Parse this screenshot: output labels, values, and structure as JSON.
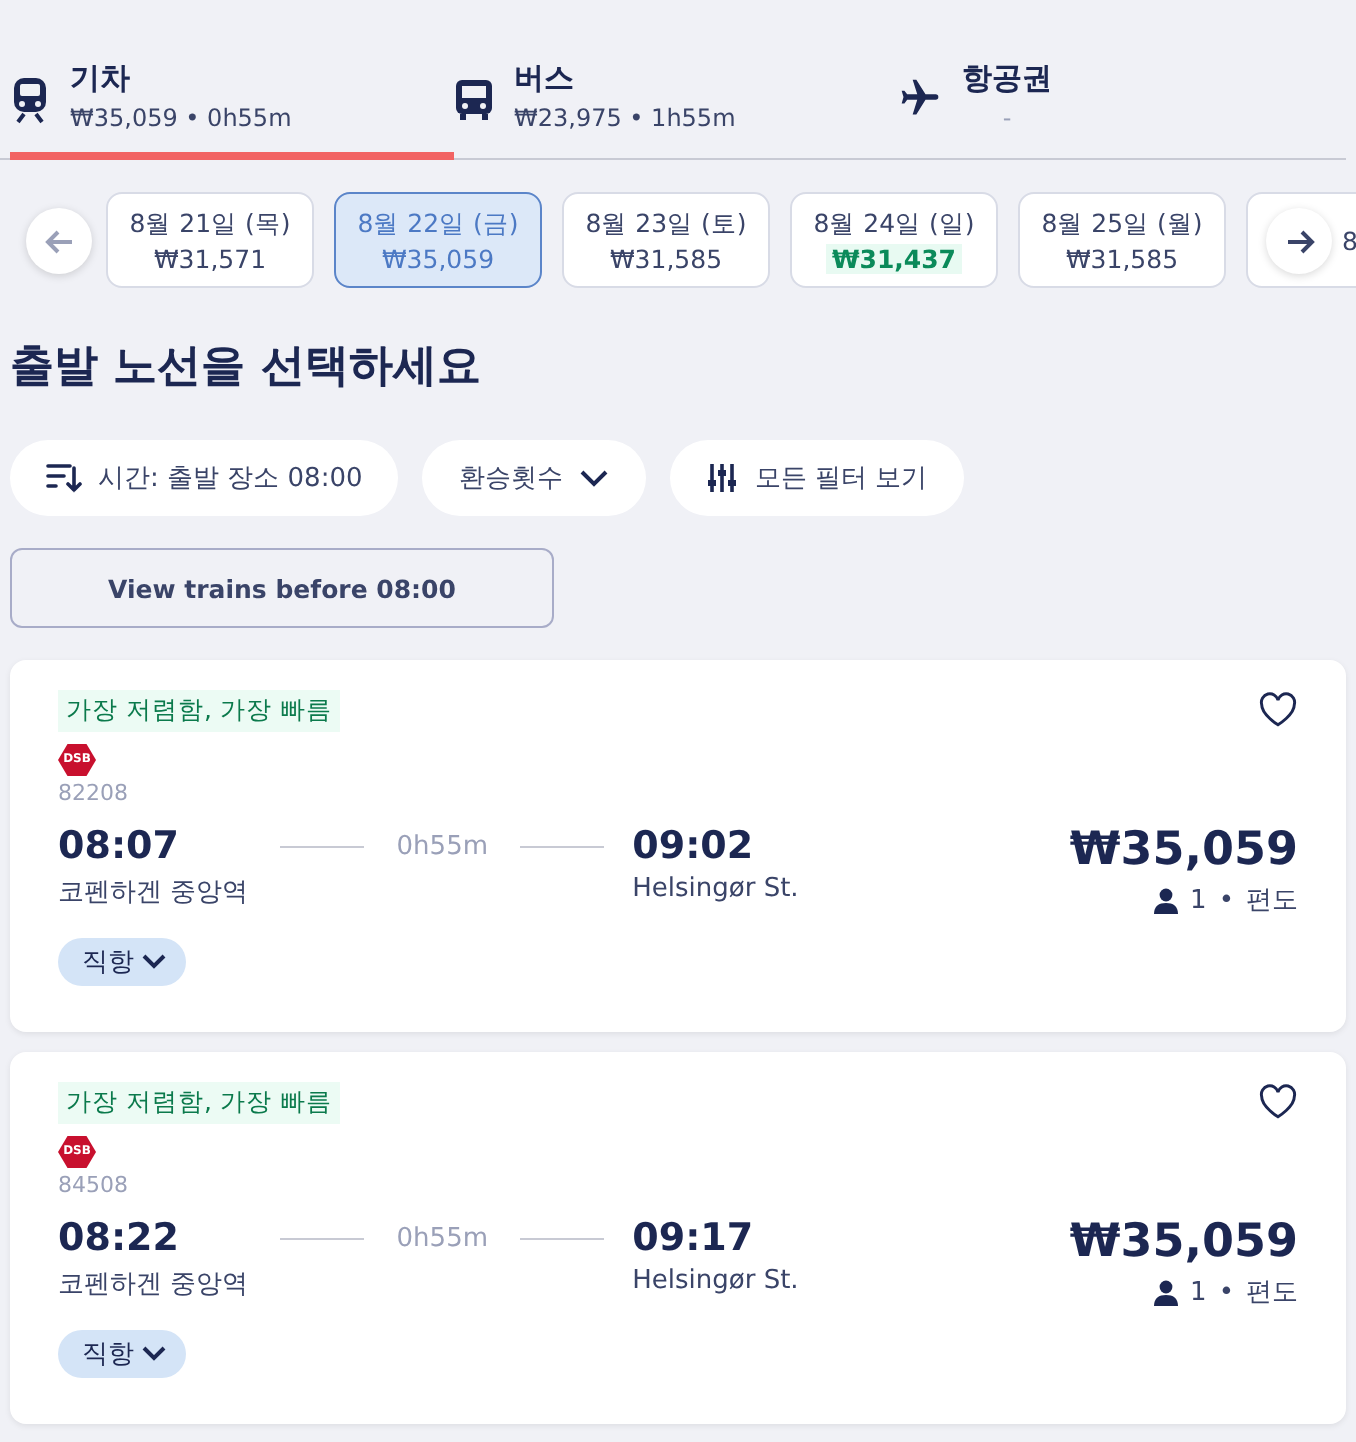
{
  "mode_tabs": [
    {
      "kind": "train",
      "label": "기차",
      "detail": "₩35,059 • 0h55m",
      "selected": true
    },
    {
      "kind": "bus",
      "label": "버스",
      "detail": "₩23,975 • 1h55m",
      "selected": false
    },
    {
      "kind": "plane",
      "label": "항공권",
      "detail": "-",
      "selected": false
    }
  ],
  "dates": [
    {
      "date": "8월 21일 (목)",
      "price": "₩31,571",
      "selected": false
    },
    {
      "date": "8월 22일 (금)",
      "price": "₩35,059",
      "selected": true
    },
    {
      "date": "8월 23일 (토)",
      "price": "₩31,585",
      "selected": false
    },
    {
      "date": "8월 24일 (일)",
      "price": "₩31,437",
      "selected": false,
      "cheapest": true
    },
    {
      "date": "8월 25일 (월)",
      "price": "₩31,585",
      "selected": false
    },
    {
      "date": "8",
      "selected": false
    }
  ],
  "heading": "출발 노선을 선택하세요",
  "filters": [
    {
      "kind": "sort",
      "label": "시간: 출발 장소 08:00"
    },
    {
      "kind": "dropdown",
      "label": "환승횟수"
    },
    {
      "kind": "all",
      "label": "모든 필터 보기"
    }
  ],
  "earlier_button": "View trains before 08:00",
  "results": [
    {
      "tag": "가장 저렴함, 가장 빠름",
      "operator": "DSB",
      "train_number": "82208",
      "depart_time": "08:07",
      "duration": "0h55m",
      "arrive_time": "09:02",
      "depart_station": "코펜하겐 중앙역",
      "arrive_station": "Helsingør St.",
      "price": "₩35,059",
      "passengers": "1",
      "separator": "•",
      "trip_type": "편도",
      "stops": "직항",
      "saved": false
    },
    {
      "tag": "가장 저렴함, 가장 빠름",
      "operator": "DSB",
      "train_number": "84508",
      "depart_time": "08:22",
      "duration": "0h55m",
      "arrive_time": "09:17",
      "depart_station": "코펜하겐 중앙역",
      "arrive_station": "Helsingør St.",
      "price": "₩35,059",
      "passengers": "1",
      "separator": "•",
      "trip_type": "편도",
      "stops": "직항",
      "saved": false
    }
  ]
}
